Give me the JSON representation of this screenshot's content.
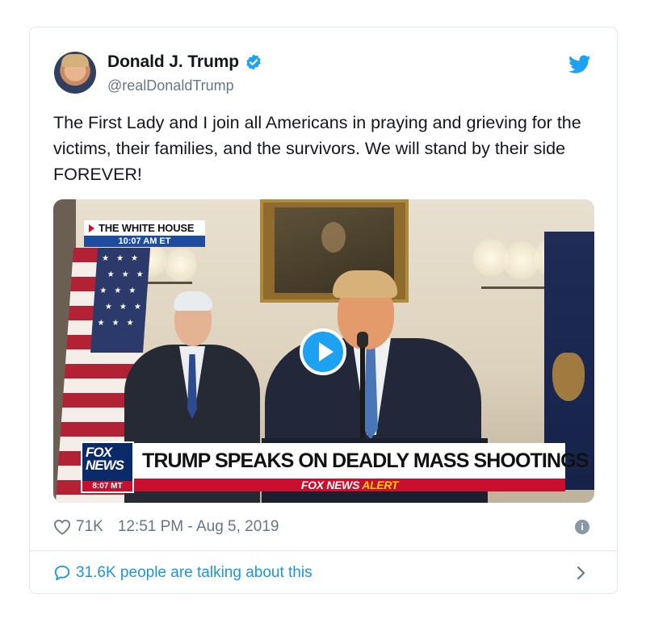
{
  "tweet": {
    "author_name": "Donald J. Trump",
    "handle": "@realDonaldTrump",
    "verified": true,
    "text": "The First Lady and I join all Americans in praying and grieving for the victims, their families, and the survivors. We will stand by their side FOREVER!",
    "likes": "71K",
    "timestamp": "12:51 PM - Aug 5, 2019",
    "talking_count_text": "31.6K people are talking about this"
  },
  "video": {
    "location_label": "THE WHITE HOUSE",
    "location_time": "10:07 AM ET",
    "channel_logo_line1": "FOX",
    "channel_logo_line2": "NEWS",
    "channel_time": "8:07 MT",
    "headline": "TRUMP SPEAKS ON DEADLY MASS SHOOTINGS",
    "alert_part1": "FOX NEWS",
    "alert_part2": "ALERT"
  },
  "colors": {
    "twitter_blue": "#1da1f2",
    "link_blue": "#1b95e0",
    "secondary_text": "#657786",
    "border": "#e1e8ed",
    "fox_red": "#c8102e",
    "fox_navy": "#0b2a6a"
  },
  "icons": {
    "verified": "verified-badge-icon",
    "bird": "twitter-bird-icon",
    "heart": "heart-icon",
    "info": "info-icon",
    "bubble": "speech-bubble-icon",
    "chevron": "chevron-right-icon",
    "play": "play-icon"
  }
}
